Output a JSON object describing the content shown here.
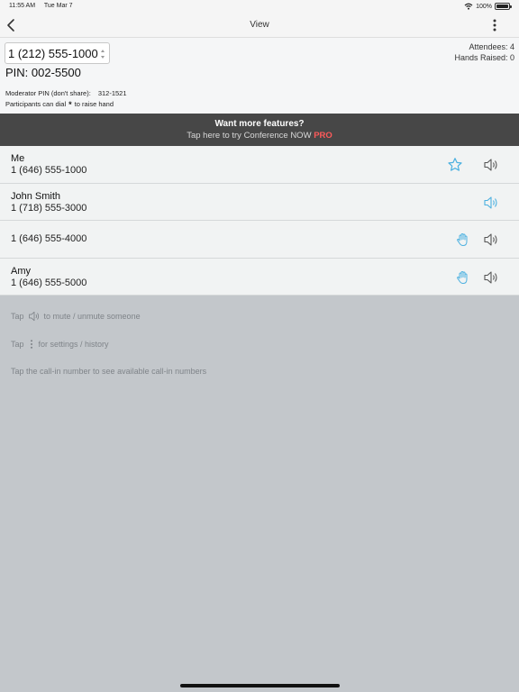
{
  "status_bar": {
    "time": "11:55 AM",
    "date": "Tue Mar 7",
    "battery": "100%"
  },
  "nav": {
    "title": "View"
  },
  "conference": {
    "dial_in": "1 (212) 555-1000",
    "pin": "PIN: 002-5500",
    "attendees": "Attendees: 4",
    "hands_raised": "Hands Raised: 0",
    "moderator_pin_label": "Moderator PIN (don't share):",
    "moderator_pin": "312-1521",
    "raise_hand_pre": "Participants can dial",
    "raise_hand_key": "*",
    "raise_hand_post": "to raise hand"
  },
  "banner": {
    "title": "Want more features?",
    "subtitle": "Tap here to try Conference NOW",
    "pro": "PRO"
  },
  "participants": [
    {
      "name": "Me",
      "phone": "1 (646) 555-1000",
      "icons": [
        "star-icon",
        "speaker-icon"
      ]
    },
    {
      "name": "John Smith",
      "phone": "1 (718) 555-3000",
      "icons": [
        "speaker-icon"
      ]
    },
    {
      "name": "",
      "phone": "1 (646) 555-4000",
      "icons": [
        "raise-hand-icon",
        "speaker-icon"
      ]
    },
    {
      "name": "Amy",
      "phone": "1 (646) 555-5000",
      "icons": [
        "raise-hand-icon",
        "speaker-icon"
      ]
    }
  ],
  "hints": {
    "mute_pre": "Tap",
    "mute_post": "to mute / unmute someone",
    "settings_pre": "Tap",
    "settings_post": "for settings / history",
    "callin": "Tap the call-in number to see available call-in numbers"
  },
  "colors": {
    "accent": "#4bb0e0",
    "banner_bg": "#474747",
    "pro": "#ff5a5a"
  }
}
